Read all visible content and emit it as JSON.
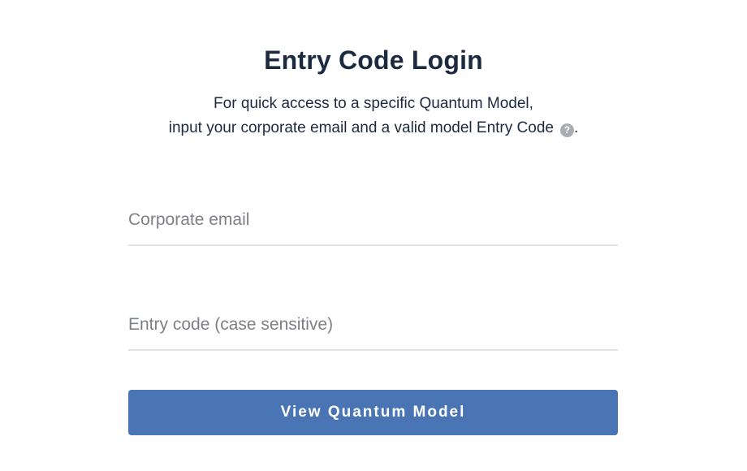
{
  "header": {
    "title": "Entry Code Login",
    "subtitle_line1": "For quick access to a specific Quantum Model,",
    "subtitle_line2": "input your corporate email and a valid model Entry Code",
    "subtitle_end": ".",
    "help_icon_glyph": "?",
    "help_icon": "question-mark-circle"
  },
  "form": {
    "email_placeholder": "Corporate email",
    "email_value": "",
    "code_placeholder": "Entry code (case sensitive)",
    "code_value": "",
    "submit_label": "View Quantum Model"
  },
  "colors": {
    "heading": "#1c2a3f",
    "button": "#4a75b5",
    "underline": "#e1e3e6",
    "placeholder": "#7d8085"
  }
}
